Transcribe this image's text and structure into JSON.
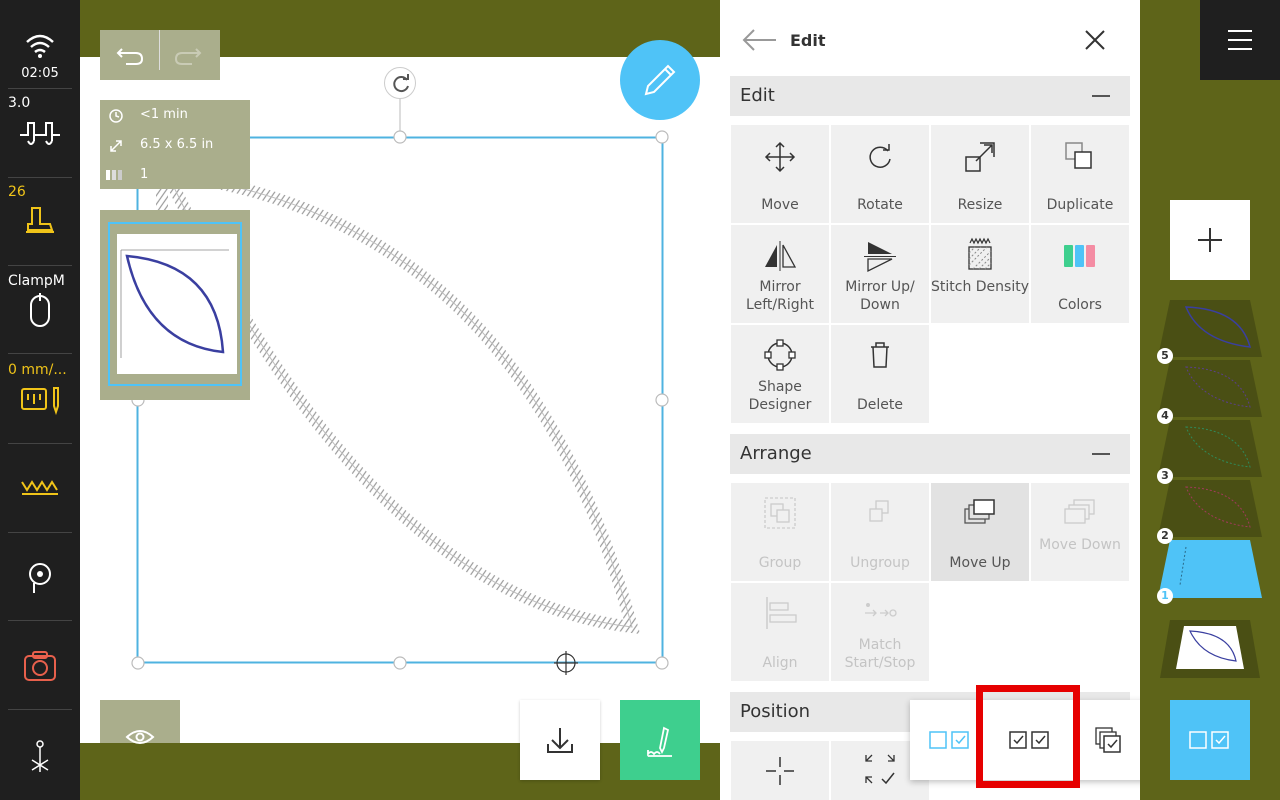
{
  "sidebar": {
    "time": "02:05",
    "speed": "3.0",
    "presser_value": "26",
    "hoop": "ClampM",
    "feed": "0 mm/..."
  },
  "canvas": {
    "info": {
      "time": "<1 min",
      "size": "6.5 x 6.5 in",
      "colors_count": "1"
    }
  },
  "panel": {
    "title": "Edit",
    "sections": {
      "edit": {
        "title": "Edit",
        "tools": [
          "Move",
          "Rotate",
          "Resize",
          "Duplicate",
          "Mirror Left/Right",
          "Mirror Up/ Down",
          "Stitch Density",
          "Colors",
          "Shape Designer",
          "Delete"
        ]
      },
      "arrange": {
        "title": "Arrange",
        "tools": [
          "Group",
          "Ungroup",
          "Move Up",
          "Move Down",
          "Align",
          "Match Start/Stop"
        ]
      },
      "position": {
        "title": "Position"
      }
    }
  },
  "layers": {
    "numbers": [
      "5",
      "4",
      "3",
      "2",
      "1"
    ]
  },
  "colors": {
    "accent": "#4fc3f7",
    "olive": "#5e6419",
    "green": "#3ecf8e",
    "highlight": "#e60000"
  }
}
